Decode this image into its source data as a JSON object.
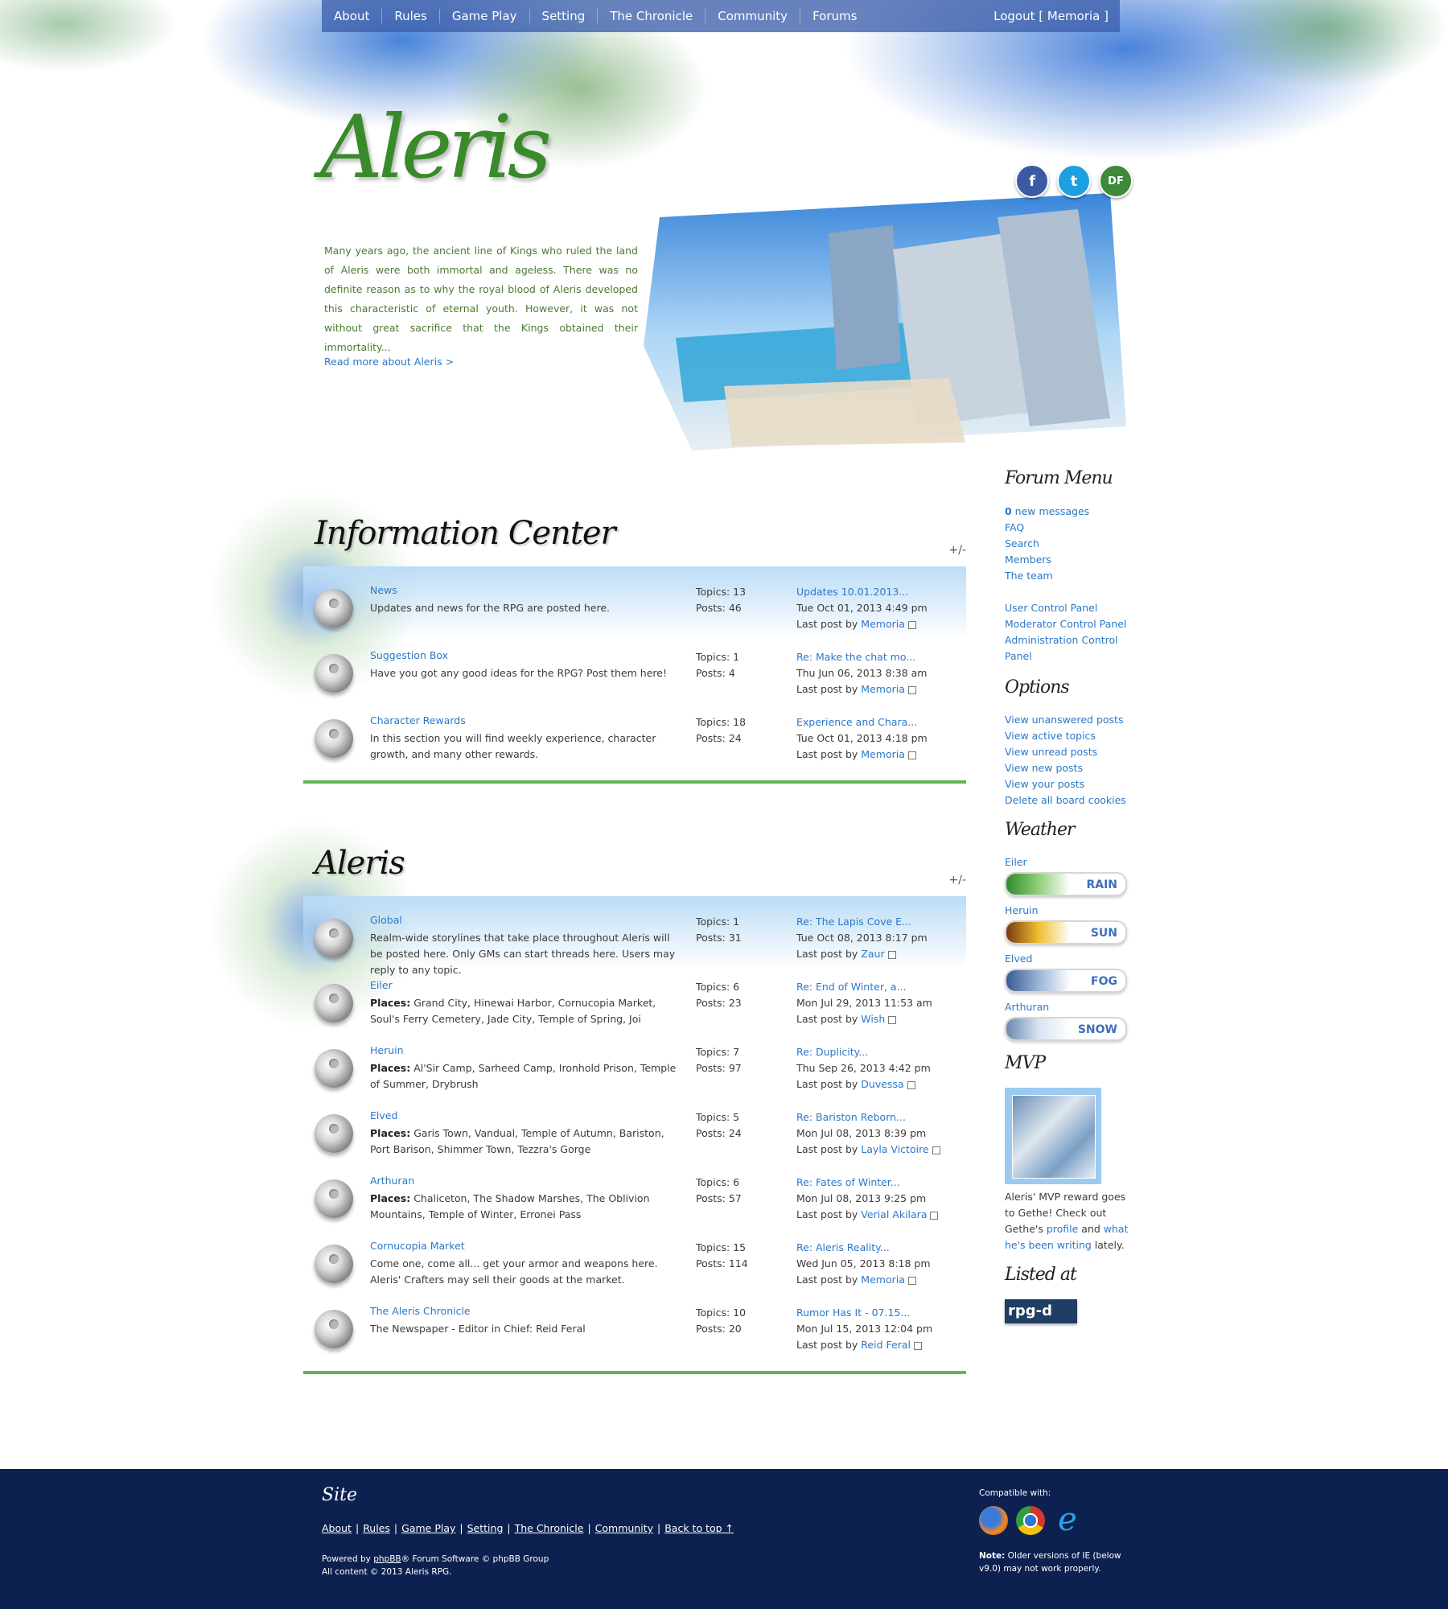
{
  "nav": {
    "items": [
      "About",
      "Rules",
      "Game Play",
      "Setting",
      "The Chronicle",
      "Community",
      "Forums"
    ],
    "logout": "Logout [ Memoria ]"
  },
  "header": {
    "logo": "Aleris",
    "intro": "Many years ago, the ancient line of Kings who ruled the land of Aleris were both immortal and ageless. There was no definite reason as to why the royal blood of Aleris developed this characteristic of eternal youth. However, it was not without great sacrifice that the Kings obtained their immortality...",
    "read_more": "Read more about Aleris >",
    "social": [
      "f",
      "t",
      "DF"
    ]
  },
  "categories": [
    {
      "title": "Information Center",
      "toggle": "+/-",
      "forums": [
        {
          "name": "News",
          "desc": "Updates and news for the RPG are posted here.",
          "places": "",
          "topics": "Topics: 13",
          "posts": "Posts: 46",
          "last_title": "Updates 10.01.2013...",
          "last_date": "Tue Oct 01, 2013 4:49 pm",
          "last_by": "Last post by",
          "last_user": "Memoria"
        },
        {
          "name": "Suggestion Box",
          "desc": "Have you got any good ideas for the RPG? Post them here!",
          "places": "",
          "topics": "Topics: 1",
          "posts": "Posts: 4",
          "last_title": "Re: Make the chat mo...",
          "last_date": "Thu Jun 06, 2013 8:38 am",
          "last_by": "Last post by",
          "last_user": "Memoria"
        },
        {
          "name": "Character Rewards",
          "desc": "In this section you will find weekly experience, character growth, and many other rewards.",
          "places": "",
          "topics": "Topics: 18",
          "posts": "Posts: 24",
          "last_title": "Experience and Chara...",
          "last_date": "Tue Oct 01, 2013 4:18 pm",
          "last_by": "Last post by",
          "last_user": "Memoria"
        }
      ]
    },
    {
      "title": "Aleris",
      "toggle": "+/-",
      "forums": [
        {
          "name": "Global",
          "desc": "Realm-wide storylines that take place throughout Aleris will be posted here. Only GMs can start threads here. Users may reply to any topic.",
          "places": "",
          "topics": "Topics: 1",
          "posts": "Posts: 31",
          "last_title": "Re: The Lapis Cove E...",
          "last_date": "Tue Oct 08, 2013 8:17 pm",
          "last_by": "Last post by",
          "last_user": "Zaur"
        },
        {
          "name": "Eiler",
          "places": "Places:",
          "desc": " Grand City, Hinewai Harbor, Cornucopia Market, Soul's Ferry Cemetery, Jade City, Temple of Spring, Joi",
          "topics": "Topics: 6",
          "posts": "Posts: 23",
          "last_title": "Re: End of Winter, a...",
          "last_date": "Mon Jul 29, 2013 11:53 am",
          "last_by": "Last post by",
          "last_user": "Wish"
        },
        {
          "name": "Heruin",
          "places": "Places:",
          "desc": " Al'Sir Camp, Sarheed Camp, Ironhold Prison, Temple of Summer, Drybrush",
          "topics": "Topics: 7",
          "posts": "Posts: 97",
          "last_title": "Re: Duplicity...",
          "last_date": "Thu Sep 26, 2013 4:42 pm",
          "last_by": "Last post by",
          "last_user": "Duvessa"
        },
        {
          "name": "Elved",
          "places": "Places:",
          "desc": " Garis Town, Vandual, Temple of Autumn, Bariston, Port Barison, Shimmer Town, Tezzra's Gorge",
          "topics": "Topics: 5",
          "posts": "Posts: 24",
          "last_title": "Re: Bariston Reborn...",
          "last_date": "Mon Jul 08, 2013 8:39 pm",
          "last_by": "Last post by",
          "last_user": "Layla Victoire"
        },
        {
          "name": "Arthuran",
          "places": "Places:",
          "desc": " Chaliceton, The Shadow Marshes, The Oblivion Mountains, Temple of Winter, Erronei Pass",
          "topics": "Topics: 6",
          "posts": "Posts: 57",
          "last_title": "Re: Fates of Winter...",
          "last_date": "Mon Jul 08, 2013 9:25 pm",
          "last_by": "Last post by",
          "last_user": "Verial Akilara"
        },
        {
          "name": "Cornucopia Market",
          "places": "",
          "desc": "Come one, come all... get your armor and weapons here. Aleris' Crafters may sell their goods at the market.",
          "topics": "Topics: 15",
          "posts": "Posts: 114",
          "last_title": "Re: Aleris Reality...",
          "last_date": "Wed Jun 05, 2013 8:18 pm",
          "last_by": "Last post by",
          "last_user": "Memoria"
        },
        {
          "name": "The Aleris Chronicle",
          "places": "",
          "desc": "The Newspaper - Editor in Chief: Reid Feral",
          "topics": "Topics: 10",
          "posts": "Posts: 20",
          "last_title": "Rumor Has It - 07.15...",
          "last_date": "Mon Jul 15, 2013 12:04 pm",
          "last_by": "Last post by",
          "last_user": "Reid Feral"
        }
      ]
    }
  ],
  "sidebar": {
    "forum_menu_title": "Forum Menu",
    "new_count": "0",
    "new_label": " new messages",
    "menu_links": [
      "FAQ",
      "Search",
      "Members",
      "The team"
    ],
    "panel_links": [
      "User Control Panel",
      "Moderator Control Panel",
      "Administration Control Panel"
    ],
    "options_title": "Options",
    "options_links": [
      "View unanswered posts",
      "View active topics",
      "View unread posts",
      "View new posts",
      "View your posts",
      "Delete all board cookies"
    ],
    "weather_title": "Weather",
    "weather": [
      {
        "region": "Eiler",
        "condition": "RAIN",
        "color": "#3a9a3a"
      },
      {
        "region": "Heruin",
        "condition": "SUN",
        "color": "#e0a020"
      },
      {
        "region": "Elved",
        "condition": "FOG",
        "color": "#4a6aa0"
      },
      {
        "region": "Arthuran",
        "condition": "SNOW",
        "color": "#8aa8c8"
      }
    ],
    "mvp_title": "MVP",
    "mvp_text_1": "Aleris' MVP reward goes to Gethe! Check out Gethe's ",
    "mvp_profile": "profile",
    "mvp_and": " and ",
    "mvp_writing": "what he's been writing",
    "mvp_end": " lately.",
    "listed_title": "Listed at",
    "listed_badge": "rpg-d"
  },
  "footer": {
    "title": "Site",
    "links": [
      "About",
      "Rules",
      "Game Play",
      "Setting",
      "The Chronicle",
      "Community",
      "Back to top ↑"
    ],
    "powered_1": "Powered by ",
    "phpbb": "phpBB",
    "powered_2": "® Forum Software © phpBB Group",
    "copyright": "All content © 2013 Aleris RPG.",
    "compatible": "Compatible with:",
    "note_label": "Note:",
    "note_text": " Older versions of IE (below v9.0) may not work properly."
  },
  "colors": {
    "accent": "#2a78c8",
    "rule": "#5fb84c",
    "footer": "#0d2150",
    "nav": "#3c5faa"
  }
}
